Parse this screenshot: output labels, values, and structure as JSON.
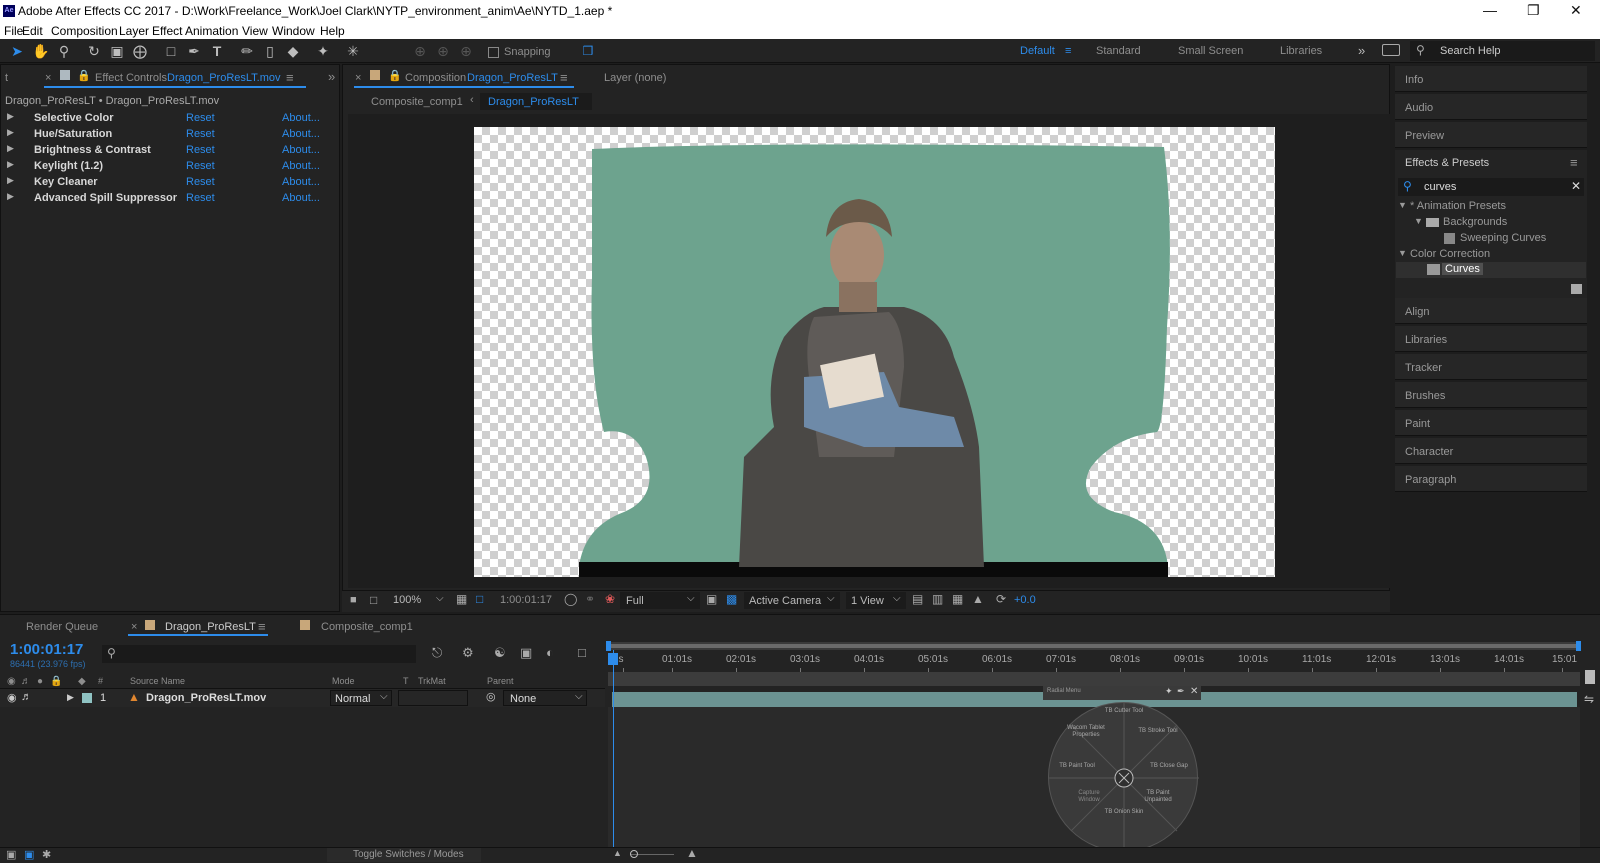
{
  "app": {
    "title": "Adobe After Effects CC 2017 - D:\\Work\\Freelance_Work\\Joel Clark\\NYTP_environment_anim\\Ae\\NYTD_1.aep *",
    "icon_text": "Ae",
    "menu": [
      "File",
      "Edit",
      "Composition",
      "Layer",
      "Effect",
      "Animation",
      "View",
      "Window",
      "Help"
    ]
  },
  "toolbar": {
    "snapping_label": "Snapping",
    "workspaces": [
      "Default",
      "Standard",
      "Small Screen",
      "Libraries"
    ],
    "active_workspace": "Default",
    "search_help": "Search Help"
  },
  "effect_controls": {
    "tab_label": "Effect Controls",
    "tab_source": "Dragon_ProResLT.mov",
    "layer_path": "Dragon_ProResLT • Dragon_ProResLT.mov",
    "effects": [
      {
        "name": "Selective Color",
        "reset": "Reset",
        "about": "About..."
      },
      {
        "name": "Hue/Saturation",
        "reset": "Reset",
        "about": "About..."
      },
      {
        "name": "Brightness & Contrast",
        "reset": "Reset",
        "about": "About..."
      },
      {
        "name": "Keylight (1.2)",
        "reset": "Reset",
        "about": "About..."
      },
      {
        "name": "Key Cleaner",
        "reset": "Reset",
        "about": "About..."
      },
      {
        "name": "Advanced Spill Suppressor",
        "reset": "Reset",
        "about": "About..."
      }
    ]
  },
  "composition": {
    "tab_label": "Composition",
    "tab_name": "Dragon_ProResLT",
    "layer_label": "Layer (none)",
    "breadcrumbs": [
      "Composite_comp1",
      "Dragon_ProResLT"
    ],
    "zoom": "100%",
    "timecode": "1:00:01:17",
    "resolution": "Full",
    "camera": "Active Camera",
    "views": "1 View",
    "exposure": "+0.0"
  },
  "right_panel": {
    "items_top": [
      "Info",
      "Audio",
      "Preview"
    ],
    "effects_presets_label": "Effects & Presets",
    "search_value": "curves",
    "tree": [
      {
        "label": "* Animation Presets",
        "level": 0
      },
      {
        "label": "Backgrounds",
        "level": 1
      },
      {
        "label": "Sweeping Curves",
        "level": 2
      },
      {
        "label": "Color Correction",
        "level": 0
      },
      {
        "label": "Curves",
        "level": 1
      }
    ],
    "items_bottom": [
      "Align",
      "Libraries",
      "Tracker",
      "Brushes",
      "Paint",
      "Character",
      "Paragraph"
    ]
  },
  "timeline": {
    "tabs": [
      "Render Queue",
      "Dragon_ProResLT",
      "Composite_comp1"
    ],
    "timecode": "1:00:01:17",
    "frames": "86441 (23.976 fps)",
    "columns": [
      "#",
      "Source Name",
      "Mode",
      "T",
      "TrkMat",
      "Parent"
    ],
    "layer": {
      "index": "1",
      "name": "Dragon_ProResLT.mov",
      "mode": "Normal",
      "parent": "None"
    },
    "ruler_ticks": [
      "1s",
      "01:01s",
      "02:01s",
      "03:01s",
      "04:01s",
      "05:01s",
      "06:01s",
      "07:01s",
      "08:01s",
      "09:01s",
      "10:01s",
      "11:01s",
      "12:01s",
      "13:01s",
      "14:01s",
      "15:01"
    ],
    "toggle_label": "Toggle Switches / Modes"
  },
  "radial_menu": {
    "title": "Radial Menu",
    "items": [
      "TB Cutter Tool",
      "TB Stroke Tool",
      "TB Close Gap",
      "TB Paint Unpainted",
      "TB Onion Skin",
      "Capture Window",
      "TB Paint Tool",
      "Wacom Tablet Properties"
    ]
  }
}
